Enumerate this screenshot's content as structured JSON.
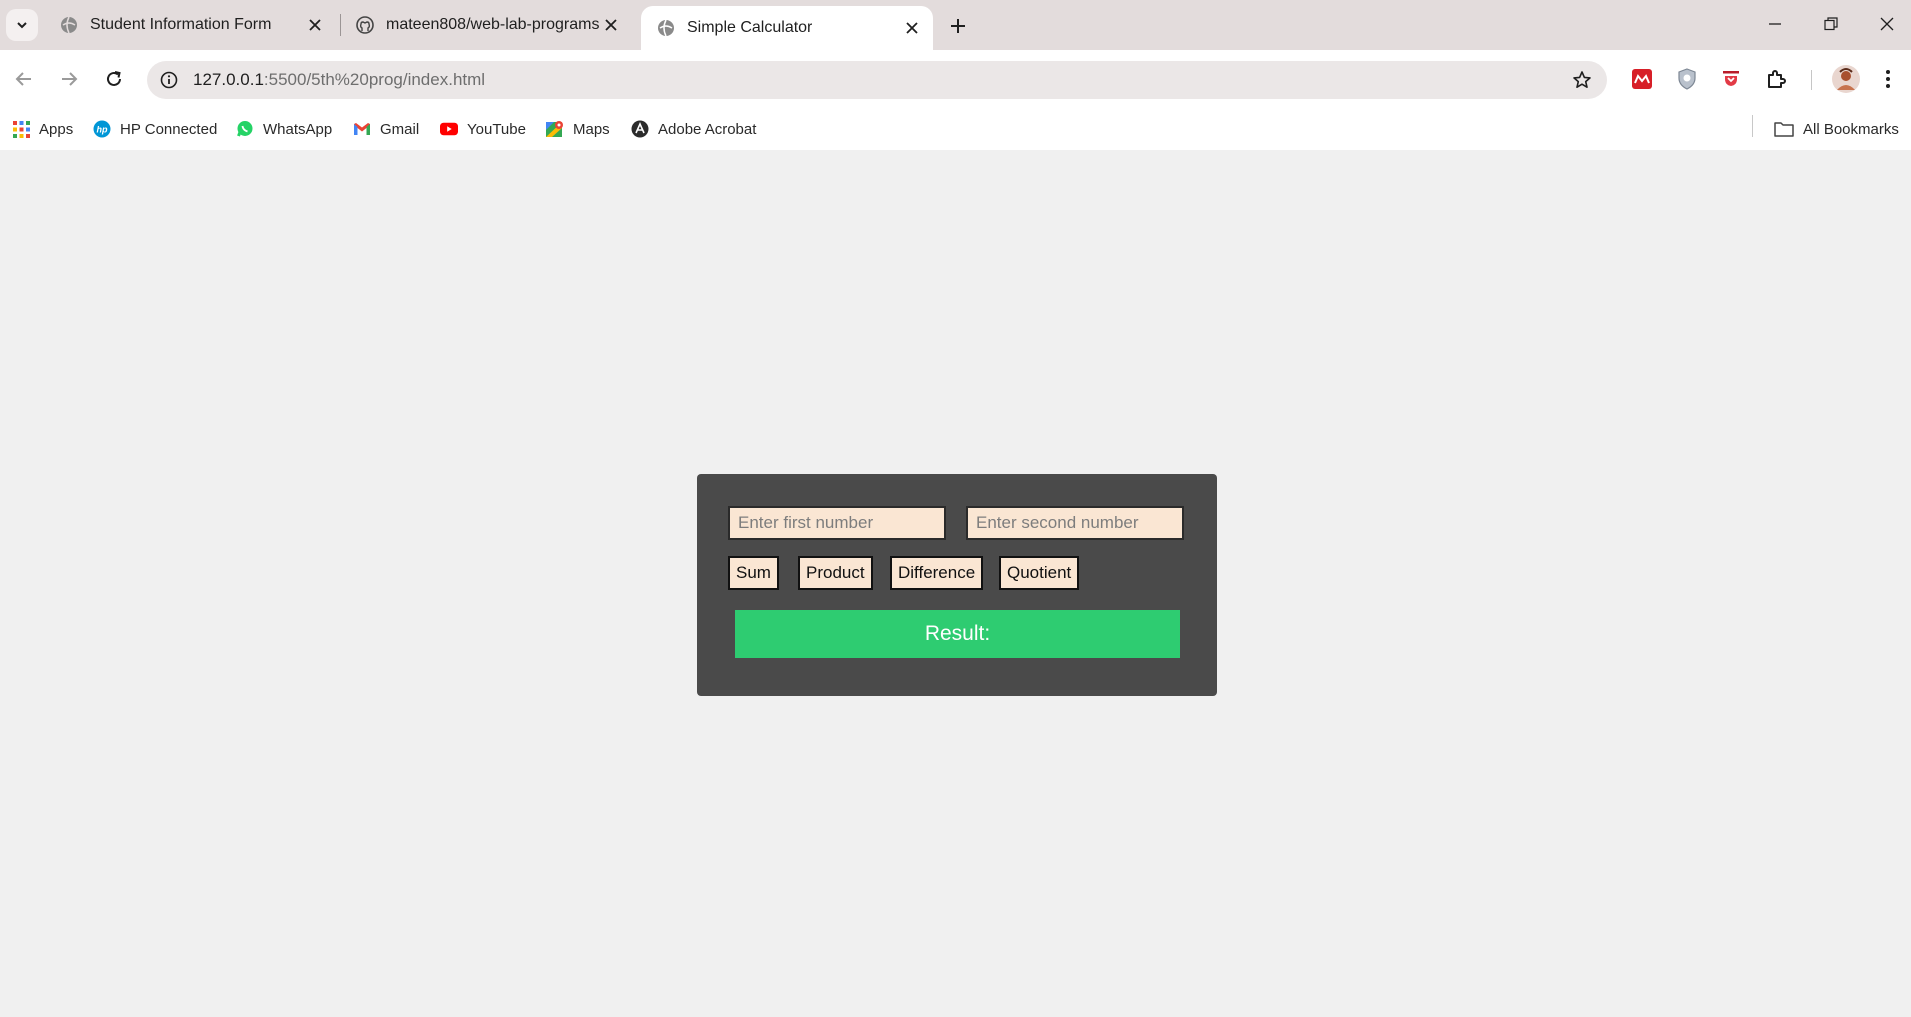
{
  "browser": {
    "tabs": [
      {
        "title": "Student Information Form",
        "icon": "globe-icon"
      },
      {
        "title": "mateen808/web-lab-programs",
        "icon": "github-icon"
      },
      {
        "title": "Simple Calculator",
        "icon": "globe-icon",
        "active": true
      }
    ],
    "url": {
      "host": "127.0.0.1",
      "path": ":5500/5th%20prog/index.html"
    },
    "bookmarks": [
      {
        "label": "Apps",
        "icon": "apps-grid-icon"
      },
      {
        "label": "HP Connected",
        "icon": "hp-icon"
      },
      {
        "label": "WhatsApp",
        "icon": "whatsapp-icon"
      },
      {
        "label": "Gmail",
        "icon": "gmail-icon"
      },
      {
        "label": "YouTube",
        "icon": "youtube-icon"
      },
      {
        "label": "Maps",
        "icon": "maps-icon"
      },
      {
        "label": "Adobe Acrobat",
        "icon": "acrobat-icon"
      }
    ],
    "all_bookmarks": "All Bookmarks"
  },
  "calculator": {
    "first_placeholder": "Enter first number",
    "second_placeholder": "Enter second number",
    "buttons": {
      "sum": "Sum",
      "product": "Product",
      "difference": "Difference",
      "quotient": "Quotient"
    },
    "result_label": "Result:"
  },
  "colors": {
    "panel": "#4a4a4a",
    "input_bg": "#fae6d3",
    "result_bg": "#2ecc71",
    "page_bg": "#f0f0f0"
  }
}
